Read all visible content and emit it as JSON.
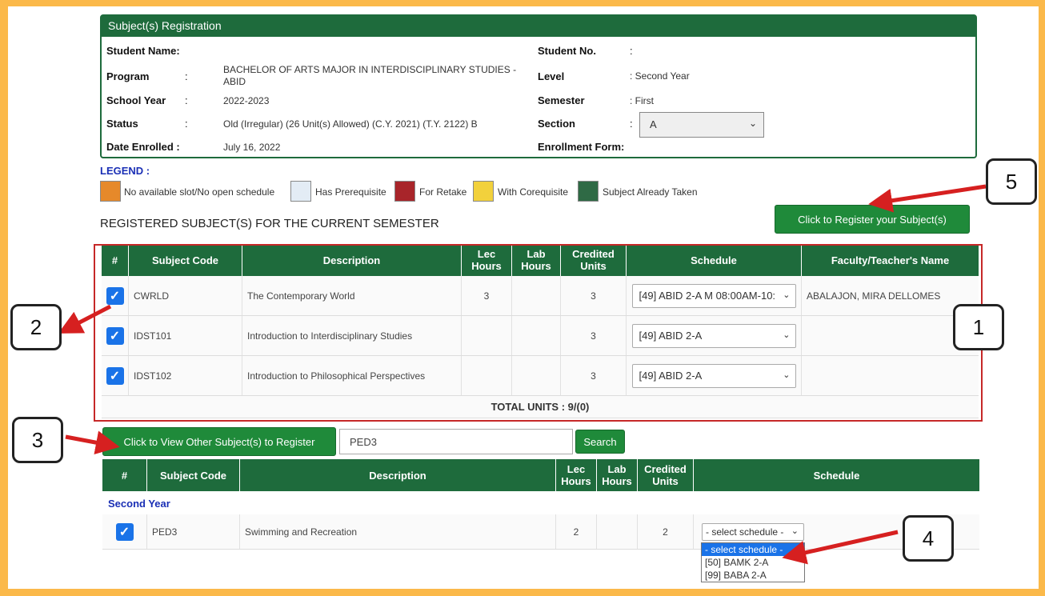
{
  "panel": {
    "title": "Subject(s) Registration",
    "labels": {
      "student_name": "Student Name:",
      "program": "Program",
      "school_year": "School Year",
      "status": "Status",
      "date_enrolled": "Date Enrolled :",
      "student_no": "Student No.",
      "level": "Level",
      "semester": "Semester",
      "section": "Section",
      "enrollment_form": "Enrollment Form:"
    },
    "colon": ":",
    "values": {
      "program": "BACHELOR OF ARTS MAJOR IN INTERDISCIPLINARY STUDIES - ABID",
      "school_year": "2022-2023",
      "status": "Old (Irregular) (26 Unit(s) Allowed) (C.Y. 2021) (T.Y. 2122) B",
      "date_enrolled": "July 16, 2022",
      "level": ": Second Year",
      "semester": ": First",
      "section": "A"
    }
  },
  "legend": {
    "title": "LEGEND :",
    "items": [
      {
        "label": "No available slot/No open schedule",
        "color": "#e6892a"
      },
      {
        "label": "Has Prerequisite",
        "color": "#e3ecf5"
      },
      {
        "label": "For Retake",
        "color": "#a8252a"
      },
      {
        "label": "With Corequisite",
        "color": "#f2d13c"
      },
      {
        "label": "Subject Already Taken",
        "color": "#2f6a45"
      }
    ]
  },
  "registered": {
    "heading": "REGISTERED SUBJECT(S) FOR THE CURRENT SEMESTER",
    "register_button": "Click to Register your Subject(s)",
    "headers": [
      "#",
      "Subject Code",
      "Description",
      "Lec Hours",
      "Lab Hours",
      "Credited Units",
      "Schedule",
      "Faculty/Teacher's Name"
    ],
    "rows": [
      {
        "code": "CWRLD",
        "description": "The Contemporary World",
        "lec": "3",
        "lab": "",
        "units": "3",
        "schedule": "[49] ABID 2-A M 08:00AM-10:",
        "faculty": "ABALAJON, MIRA DELLOMES"
      },
      {
        "code": "IDST101",
        "description": "Introduction to Interdisciplinary Studies",
        "lec": "",
        "lab": "",
        "units": "3",
        "schedule": "[49] ABID 2-A",
        "faculty": ""
      },
      {
        "code": "IDST102",
        "description": "Introduction to Philosophical Perspectives",
        "lec": "",
        "lab": "",
        "units": "3",
        "schedule": "[49] ABID 2-A",
        "faculty": ""
      }
    ],
    "total": "TOTAL UNITS : 9/(0)"
  },
  "other": {
    "view_button": "Click to View Other Subject(s) to Register",
    "search_value": "PED3",
    "search_button": "Search",
    "headers": [
      "#",
      "Subject Code",
      "Description",
      "Lec Hours",
      "Lab Hours",
      "Credited Units",
      "Schedule"
    ],
    "group": "Second Year",
    "rows": [
      {
        "code": "PED3",
        "description": "Swimming and Recreation",
        "lec": "2",
        "lab": "",
        "units": "2",
        "schedule": "- select schedule -"
      }
    ],
    "dropdown_options": [
      "- select schedule -",
      "[50] BAMK 2-A",
      "[99] BABA 2-A"
    ]
  },
  "callouts": [
    "1",
    "2",
    "3",
    "4",
    "5"
  ],
  "colors": {
    "green": "#1e6b3c",
    "button_green": "#1f8a3a",
    "outline_red": "#c62828",
    "arrow_red": "#d62020",
    "frame": "#fbb94a"
  }
}
